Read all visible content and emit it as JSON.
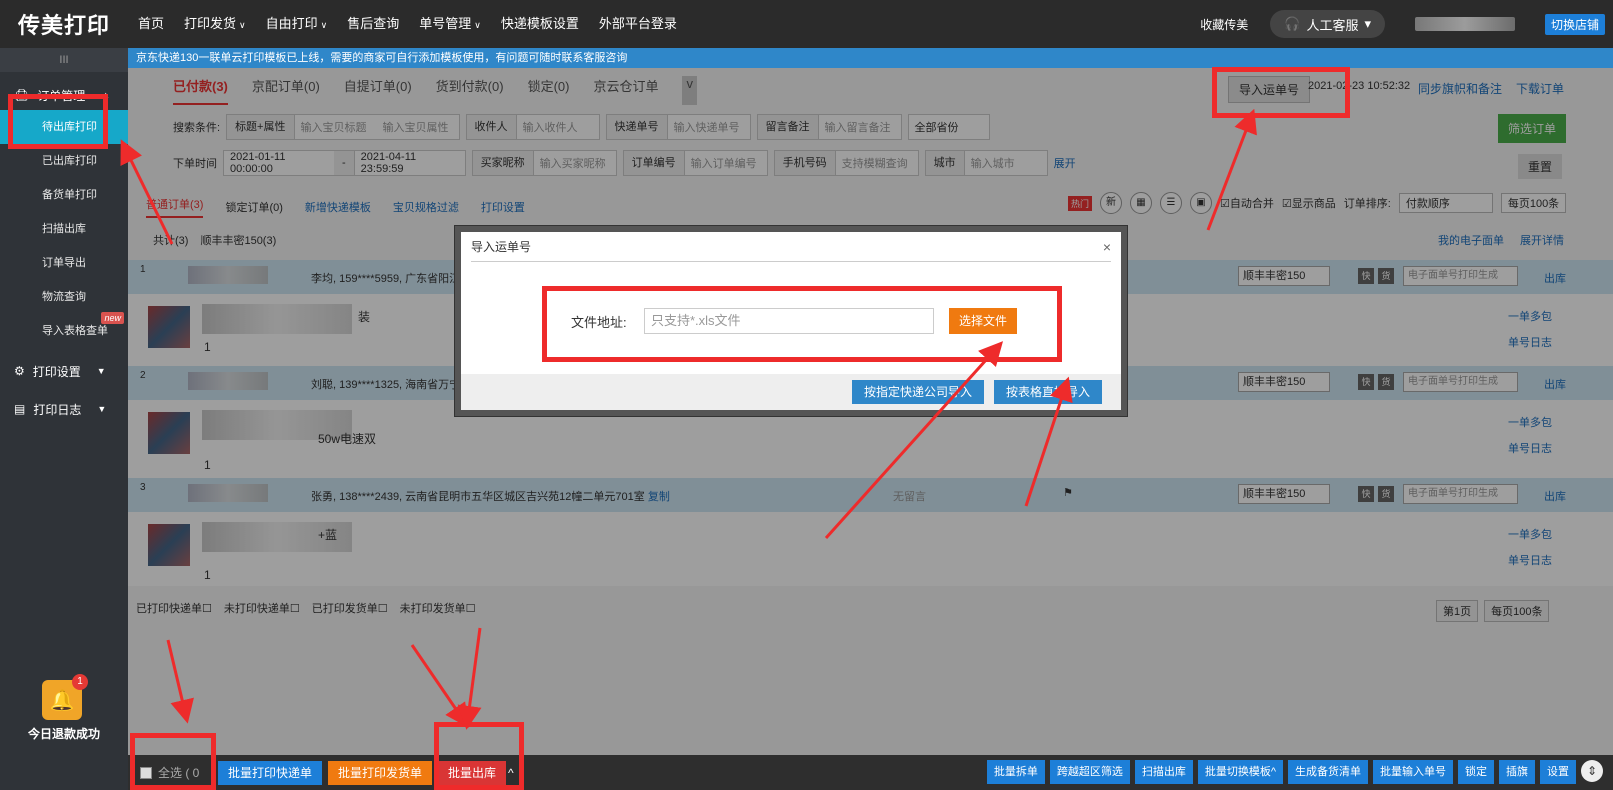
{
  "topbar": {
    "logo": "传美打印",
    "nav": [
      {
        "label": "首页",
        "dropdown": false
      },
      {
        "label": "打印发货",
        "dropdown": true
      },
      {
        "label": "自由打印",
        "dropdown": true
      },
      {
        "label": "售后查询",
        "dropdown": false
      },
      {
        "label": "单号管理",
        "dropdown": true
      },
      {
        "label": "快递模板设置",
        "dropdown": false
      },
      {
        "label": "外部平台登录",
        "dropdown": false
      }
    ],
    "fav": "收藏传美",
    "support": "人工客服",
    "switch_shop": "切换店铺"
  },
  "sidebar": {
    "collapse": "III",
    "group_orders": "订单管理",
    "items": [
      {
        "label": "待出库打印",
        "active": true
      },
      {
        "label": "已出库打印"
      },
      {
        "label": "备货单打印"
      },
      {
        "label": "扫描出库"
      },
      {
        "label": "订单导出"
      },
      {
        "label": "物流查询"
      },
      {
        "label": "导入表格查单",
        "badge": "new"
      }
    ],
    "group_print_settings": "打印设置",
    "group_print_log": "打印日志",
    "bell_count": "1",
    "refund_text": "今日退款成功"
  },
  "notice": "京东快递130一联单云打印模板已上线，需要的商家可自行添加模板使用，有问题可随时联系客服咨询",
  "tabs": [
    {
      "label": "已付款(3)",
      "active": true
    },
    {
      "label": "京配订单(0)"
    },
    {
      "label": "自提订单(0)"
    },
    {
      "label": "货到付款(0)"
    },
    {
      "label": "锁定(0)"
    },
    {
      "label": "京云仓订单"
    }
  ],
  "tab_more": "v",
  "import_waybill_btn": "导入运单号",
  "sync_time": "2021-02-23 10:52:32",
  "sync_link": "同步旗帜和备注",
  "download_link": "下载订单",
  "search": {
    "cond_label": "搜索条件:",
    "cond_select": "标题+属性",
    "title_ph": "输入宝贝标题",
    "attr_ph": "输入宝贝属性",
    "receiver_label": "收件人",
    "receiver_ph": "输入收件人",
    "express_label": "快递单号",
    "express_ph": "输入快递单号",
    "remark_label": "留言备注",
    "remark_ph": "输入留言备注",
    "province": "全部省份",
    "time_label": "下单时间",
    "time_start": "2021-01-11 00:00:00",
    "time_sep": "-",
    "time_end": "2021-04-11 23:59:59",
    "buyer_label": "买家昵称",
    "buyer_ph": "输入买家昵称",
    "order_label": "订单编号",
    "order_ph": "输入订单编号",
    "phone_label": "手机号码",
    "phone_ph": "支持模糊查询",
    "city_label": "城市",
    "city_ph": "输入城市",
    "expand": "展开",
    "filter_btn": "筛选订单",
    "reset_btn": "重置"
  },
  "subtabs": {
    "normal": "普通订单(3)",
    "locked": "锁定订单(0)",
    "add_tpl": "新增快递模板",
    "spec_filter": "宝贝规格过滤",
    "print_settings": "打印设置"
  },
  "view": {
    "hot": "热门",
    "new": "新",
    "auto_merge": "自动合并",
    "show_goods": "显示商品",
    "sort_label": "订单排序:",
    "sort_value": "付款顺序",
    "per_page": "每页100条"
  },
  "counts": {
    "total": "共计(3)",
    "sf": "顺丰丰密150(3)"
  },
  "right_links": {
    "my_ebill": "我的电子面单",
    "expand_detail": "展开详情"
  },
  "orders": [
    {
      "num": "1",
      "addr": "李均, 159****5959, 广东省阳江市",
      "express": "顺丰丰密150",
      "ebill_ph": "电子面单号打印生成",
      "out": "出库",
      "qty": "1",
      "spec": "装",
      "links": [
        "一单多包",
        "单号日志"
      ]
    },
    {
      "num": "2",
      "addr": "刘聪, 139****1325, 海南省万宁市",
      "express": "顺丰丰密150",
      "ebill_ph": "电子面单号打印生成",
      "out": "出库",
      "qty": "1",
      "spec": "50w电速双",
      "links": [
        "一单多包",
        "单号日志"
      ]
    },
    {
      "num": "3",
      "addr": "张勇, 138****2439, 云南省昆明市五华区城区吉兴苑12幢二单元701室",
      "copy": "复制",
      "no_remark": "无留言",
      "express": "顺丰丰密150",
      "ebill_ph": "电子面单号打印生成",
      "out": "出库",
      "qty": "1",
      "spec": "+蓝",
      "links": [
        "一单多包",
        "单号日志"
      ]
    }
  ],
  "tags": {
    "fast": "快",
    "goods": "货"
  },
  "bottom_filters": [
    "已打印快递单",
    "未打印快递单",
    "已打印发货单",
    "未打印发货单"
  ],
  "pager": {
    "page": "第1页",
    "per_page": "每页100条"
  },
  "bottombar": {
    "select_all": "全选 ( 0",
    "batch_express": "批量打印快递单",
    "batch_delivery": "批量打印发货单",
    "batch_out": "批量出库",
    "right": [
      "批量拆单",
      "跨越超区筛选",
      "扫描出库",
      "批量切换模板^",
      "生成备货清单",
      "批量输入单号",
      "锁定",
      "插旗",
      "设置"
    ]
  },
  "modal": {
    "title": "导入运单号",
    "close": "×",
    "file_label": "文件地址:",
    "file_ph": "只支持*.xls文件",
    "choose": "选择文件",
    "by_express": "按指定快递公司导入",
    "by_table": "按表格直接导入"
  },
  "colors": {
    "annotation_red": "#ee2b2b",
    "accent_blue": "#1d7fd8",
    "accent_orange": "#f07a10",
    "sidebar_active": "#16a8c9"
  }
}
